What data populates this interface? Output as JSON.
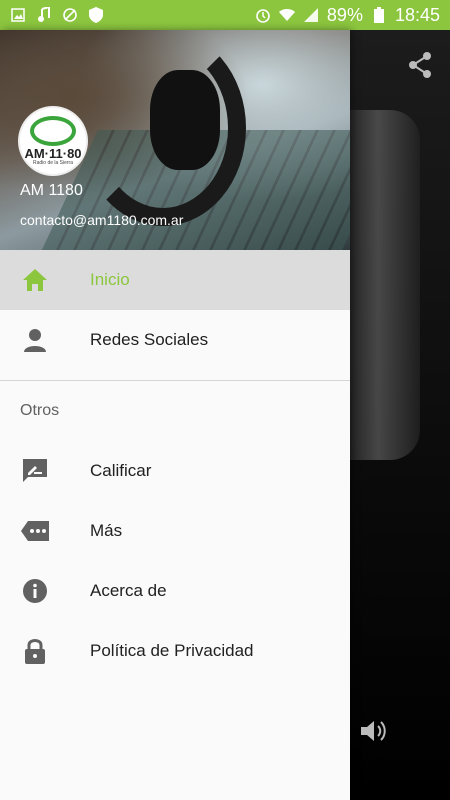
{
  "status_bar": {
    "battery": "89%",
    "time": "18:45",
    "left_icons": [
      "image-icon",
      "music-icon",
      "sync-off-icon",
      "shield-icon"
    ],
    "right_icons": [
      "alarm-icon",
      "wifi-icon",
      "signal-icon",
      "battery-icon"
    ],
    "color": "#8cc63f"
  },
  "drawer": {
    "header": {
      "logo_text": "AM·11·80",
      "logo_subtitle": "Radio de la Sierra",
      "title": "AM 1180",
      "email": "contacto@am1180.com.ar"
    },
    "items": [
      {
        "label": "Inicio",
        "icon": "home-icon",
        "active": true
      },
      {
        "label": "Redes Sociales",
        "icon": "person-icon",
        "active": false
      }
    ],
    "section_title": "Otros",
    "other_items": [
      {
        "label": "Calificar",
        "icon": "rate-review-icon"
      },
      {
        "label": "Más",
        "icon": "more-tag-icon"
      },
      {
        "label": "Acerca de",
        "icon": "info-icon"
      },
      {
        "label": "Política de Privacidad",
        "icon": "lock-icon"
      }
    ]
  },
  "accent_color": "#8cc63f",
  "main": {
    "actions": [
      "share-icon",
      "volume-icon"
    ]
  }
}
